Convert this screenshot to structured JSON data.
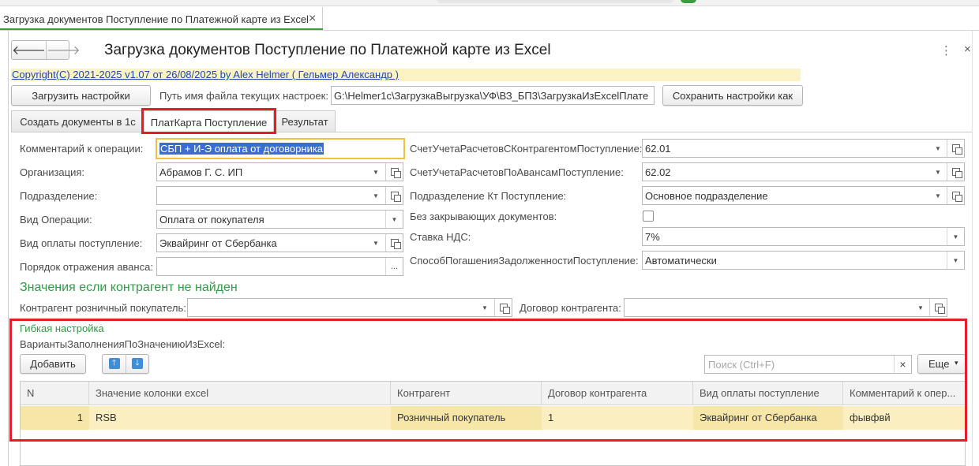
{
  "window_tab": {
    "title": "Загрузка документов Поступление по Платежной карте из Excel",
    "close": "×"
  },
  "nav": {
    "back": "🡐",
    "forward": "🡒"
  },
  "form": {
    "title": "Загрузка документов Поступление по Платежной карте из Excel",
    "more": "⋮",
    "close": "×",
    "copyright": "Copyright(C)  2021-2025 v1.07 от 26/08/2025  by Alex Helmer ( Гельмер Александр  )"
  },
  "settings": {
    "load_button": "Загрузить настройки",
    "path_label": "Путь имя файла текущих настроек:",
    "path_value": "G:\\Helmer1c\\ЗагрузкаВыгрузка\\УФ\\ВЗ_БП3\\ЗагрузкаИзExcelПлате",
    "save_button": "Сохранить настройки как"
  },
  "tabs": [
    "Создать документы в 1с",
    "ПлатКарта Поступление",
    "Результат"
  ],
  "left_fields": {
    "comment": {
      "label": "Комментарий к операции:",
      "value": "СБП + И-Э оплата от договорника"
    },
    "organization": {
      "label": "Организация:",
      "value": "Абрамов Г. С. ИП"
    },
    "department": {
      "label": "Подразделение:",
      "value": ""
    },
    "operation_type": {
      "label": "Вид Операции:",
      "value": "Оплата от покупателя"
    },
    "payment_type": {
      "label": "Вид оплаты поступление:",
      "value": "Эквайринг от Сбербанка"
    },
    "advance_order": {
      "label": "Порядок отражения аванса:",
      "value": "",
      "button": "..."
    }
  },
  "right_fields": {
    "account_settlements": {
      "label": "СчетУчетаРасчетовСКонтрагентомПоступление:",
      "value": "62.01"
    },
    "account_advances": {
      "label": "СчетУчетаРасчетовПоАвансамПоступление:",
      "value": "62.02"
    },
    "dept_kt": {
      "label": "Подразделение Кт Поступление:",
      "value": "Основное подразделение"
    },
    "no_closing_docs": {
      "label": "Без закрывающих документов:",
      "checked": false
    },
    "vat_rate": {
      "label": "Ставка НДС:",
      "value": "7%"
    },
    "debt_repayment": {
      "label": "СпособПогашенияЗадолженностиПоступление:",
      "value": "Автоматически"
    }
  },
  "not_found_section": {
    "title": "Значения если контрагент не найден",
    "retail_buyer": {
      "label": "Контрагент розничный покупатель:",
      "value": ""
    },
    "contract": {
      "label": "Договор контрагента:",
      "value": ""
    }
  },
  "flex": {
    "title": "Гибкая настройка",
    "variants_label": "ВариантыЗаполненияПоЗначениюИзExcel:",
    "add_button": "Добавить",
    "up": "🡑",
    "down": "🡓",
    "search_placeholder": "Поиск (Ctrl+F)",
    "search_clear": "×",
    "more_button": "Еще",
    "more_caret": "▾",
    "table": {
      "columns": [
        "N",
        "Значение колонки excel",
        "Контрагент",
        "Договор контрагента",
        "Вид оплаты поступление",
        "Комментарий к опер..."
      ],
      "rows": [
        [
          "1",
          "RSB",
          "Розничный покупатель",
          "1",
          "Эквайринг от Сбербанка",
          "фывфвй"
        ]
      ]
    }
  },
  "icons": {
    "dropdown": "▼",
    "open": "open-icon"
  },
  "colors": {
    "accent_green": "#2f9b45",
    "highlight_red": "#e01f26",
    "row_selected": "#fbefc1",
    "link_blue": "#1d48b3"
  }
}
